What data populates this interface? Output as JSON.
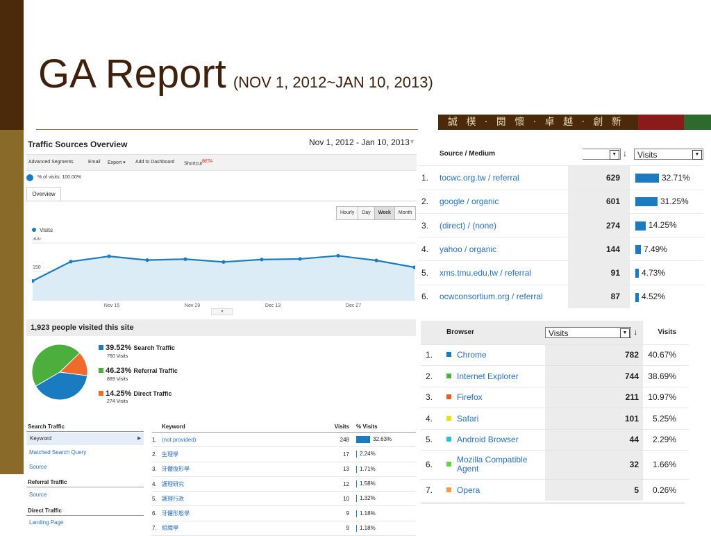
{
  "slide": {
    "title": "GA Report",
    "subtitle": "(NOV 1, 2012~JAN 10, 2013)",
    "motto": "誠 樸 · 閱 懷 · 卓 越 · 創 新"
  },
  "overview": {
    "title": "Traffic Sources Overview",
    "date_range": "Nov 1, 2012 - Jan 10, 2013",
    "toolbar": {
      "advanced_segments": "Advanced Segments",
      "email": "Email",
      "export": "Export ▾",
      "add_to_dashboard": "Add to Dashboard",
      "shortcut": "Shortcut",
      "beta": "BETA"
    },
    "segment": "% of visits: 100.00%",
    "tab": "Overview",
    "granularity": [
      "Hourly",
      "Day",
      "Week",
      "Month"
    ],
    "granularity_selected": "Week",
    "legend": "Visits"
  },
  "chart_data": {
    "type": "area",
    "series": [
      {
        "name": "Visits",
        "values": [
          100,
          202,
          230,
          210,
          215,
          200,
          213,
          216,
          233,
          208,
          172
        ]
      }
    ],
    "ylim": [
      0,
      300
    ],
    "y_ticks": [
      "300",
      "150"
    ],
    "x_tick_labels": [
      "Nov 15",
      "Nov 29",
      "Dec 13",
      "Dec 27"
    ],
    "grid": true
  },
  "visitors": {
    "header": "1,923 people visited this site",
    "sources": [
      {
        "pct": "39.52%",
        "label": "Search Traffic",
        "sub": "760 Visits",
        "color": "#1a7bc0",
        "value": 39.52
      },
      {
        "pct": "46.23%",
        "label": "Referral Traffic",
        "sub": "889 Visits",
        "color": "#4cae3c",
        "value": 46.23
      },
      {
        "pct": "14.25%",
        "label": "Direct Traffic",
        "sub": "274 Visits",
        "color": "#ef6a2b",
        "value": 14.25
      }
    ]
  },
  "nav": {
    "search_traffic": "Search Traffic",
    "keyword": "Keyword",
    "matched_query": "Matched Search Query",
    "source1": "Source",
    "referral_traffic": "Referral Traffic",
    "source2": "Source",
    "direct_traffic": "Direct Traffic",
    "landing_page": "Landing Page"
  },
  "keywords": {
    "headers": {
      "keyword": "Keyword",
      "visits": "Visits",
      "pct": "% Visits"
    },
    "rows": [
      {
        "idx": "1.",
        "keyword": "(not provided)",
        "visits": "248",
        "pct": "32.63%",
        "share": 32.63
      },
      {
        "idx": "2.",
        "keyword": "生理學",
        "visits": "17",
        "pct": "2.24%",
        "share": 2.24
      },
      {
        "idx": "3.",
        "keyword": "牙體復形學",
        "visits": "13",
        "pct": "1.71%",
        "share": 1.71
      },
      {
        "idx": "4.",
        "keyword": "護理研究",
        "visits": "12",
        "pct": "1.58%",
        "share": 1.58
      },
      {
        "idx": "5.",
        "keyword": "護理行政",
        "visits": "10",
        "pct": "1.32%",
        "share": 1.32
      },
      {
        "idx": "6.",
        "keyword": "牙體形態學",
        "visits": "9",
        "pct": "1.18%",
        "share": 1.18
      },
      {
        "idx": "7.",
        "keyword": "組織學",
        "visits": "9",
        "pct": "1.18%",
        "share": 1.18
      }
    ]
  },
  "sources_table": {
    "header": "Source / Medium",
    "metric": "Visits",
    "rows": [
      {
        "idx": "1.",
        "source": "tocwc.org.tw / referral",
        "visits": "629",
        "pct": "32.71%",
        "share": 32.71
      },
      {
        "idx": "2.",
        "source": "google / organic",
        "visits": "601",
        "pct": "31.25%",
        "share": 31.25
      },
      {
        "idx": "3.",
        "source": "(direct) / (none)",
        "visits": "274",
        "pct": "14.25%",
        "share": 14.25
      },
      {
        "idx": "4.",
        "source": "yahoo / organic",
        "visits": "144",
        "pct": "7.49%",
        "share": 7.49
      },
      {
        "idx": "5.",
        "source": "xms.tmu.edu.tw / referral",
        "visits": "91",
        "pct": "4.73%",
        "share": 4.73
      },
      {
        "idx": "6.",
        "source": "ocwconsortium.org / referral",
        "visits": "87",
        "pct": "4.52%",
        "share": 4.52
      }
    ]
  },
  "browser_table": {
    "header": "Browser",
    "metric_select": "Visits",
    "metric": "Visits",
    "rows": [
      {
        "idx": "1.",
        "browser": "Chrome",
        "visits": "782",
        "pct": "40.67%",
        "color": "#1a7bc0"
      },
      {
        "idx": "2.",
        "browser": "Internet Explorer",
        "visits": "744",
        "pct": "38.69%",
        "color": "#4cae3c"
      },
      {
        "idx": "3.",
        "browser": "Firefox",
        "visits": "211",
        "pct": "10.97%",
        "color": "#ef5b25"
      },
      {
        "idx": "4.",
        "browser": "Safari",
        "visits": "101",
        "pct": "5.25%",
        "color": "#e8e01a"
      },
      {
        "idx": "5.",
        "browser": "Android Browser",
        "visits": "44",
        "pct": "2.29%",
        "color": "#2cc0d8"
      },
      {
        "idx": "6.",
        "browser": "Mozilla Compatible Agent",
        "visits": "32",
        "pct": "1.66%",
        "color": "#6ccf4c"
      },
      {
        "idx": "7.",
        "browser": "Opera",
        "visits": "5",
        "pct": "0.26%",
        "color": "#f39a4a"
      }
    ]
  }
}
